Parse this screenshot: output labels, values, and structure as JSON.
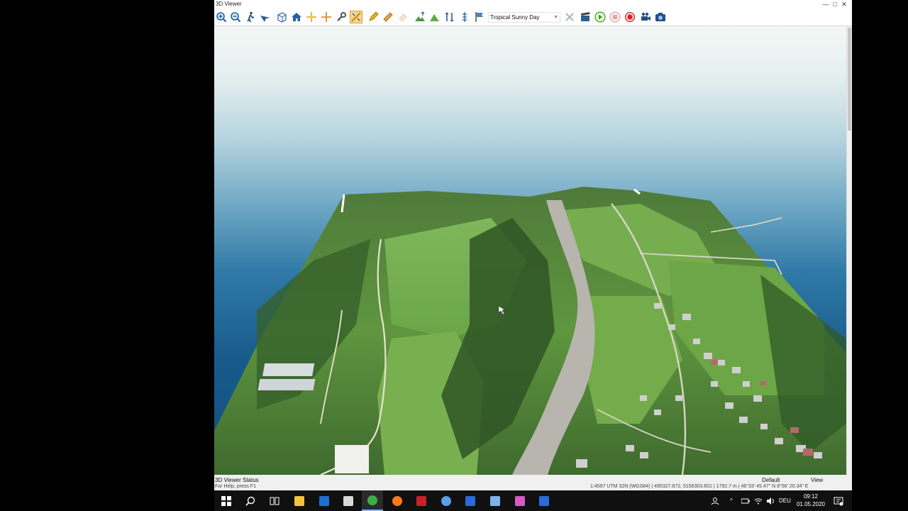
{
  "window": {
    "title": "3D Viewer",
    "controls": {
      "minimize": "—",
      "maximize": "□",
      "close": "✕"
    }
  },
  "toolbar": {
    "buttons": [
      {
        "name": "zoom-in-icon",
        "active": false
      },
      {
        "name": "zoom-out-icon",
        "active": false
      },
      {
        "name": "walk-icon",
        "active": false
      },
      {
        "name": "fly-icon",
        "active": false
      },
      {
        "name": "cube-view-icon",
        "active": false
      },
      {
        "name": "home-icon",
        "active": false
      },
      {
        "name": "center-point-icon",
        "active": false
      },
      {
        "name": "crosshair-icon",
        "active": false
      },
      {
        "name": "wrench-icon",
        "active": false
      },
      {
        "name": "measure-mode-icon",
        "active": true
      },
      {
        "name": "pencil-icon",
        "active": false
      },
      {
        "name": "ruler-icon",
        "active": false
      },
      {
        "name": "eraser-icon",
        "active": false
      },
      {
        "name": "terrain-up-icon",
        "active": false
      },
      {
        "name": "terrain-icon",
        "active": false
      },
      {
        "name": "elevation-icon",
        "active": false
      },
      {
        "name": "elevation-scale-icon",
        "active": false
      },
      {
        "name": "flag-icon",
        "active": false
      }
    ],
    "sky_select": {
      "value": "Tropical Sunny Day"
    },
    "buttons_right": [
      {
        "name": "clear-tools-icon",
        "disabled": true
      },
      {
        "name": "clapperboard-icon",
        "disabled": false
      },
      {
        "name": "play-icon",
        "disabled": false
      },
      {
        "name": "stop-icon",
        "disabled": true
      },
      {
        "name": "record-icon",
        "disabled": false
      },
      {
        "name": "video-camera-icon",
        "disabled": false
      },
      {
        "name": "camera-icon",
        "disabled": false
      }
    ]
  },
  "statusbar": {
    "title": "3D Viewer Status",
    "help": "For Help, press F1",
    "coords": "1:4597 UTM 32N (WGS84) | 495327.872, 5156303.601 | 1792.7 m | 46°33' 45.47\" N 8°56' 20.34\" E",
    "scheme": "Default",
    "mode": "View"
  },
  "taskbar": {
    "apps": [
      {
        "name": "start-icon",
        "color": "#ffffff"
      },
      {
        "name": "search-icon",
        "color": "#ffffff"
      },
      {
        "name": "task-view-icon",
        "color": "#ffffff"
      },
      {
        "name": "file-explorer-icon",
        "color": "#f3c33a"
      },
      {
        "name": "outlook-icon",
        "color": "#1f6fd1"
      },
      {
        "name": "app-window-icon",
        "color": "#d9d9d9"
      },
      {
        "name": "chrome-icon",
        "color": "#3fae49",
        "active": true
      },
      {
        "name": "firefox-icon",
        "color": "#ff7a1a"
      },
      {
        "name": "red-app-icon",
        "color": "#c9202a"
      },
      {
        "name": "globe-app-icon",
        "color": "#5aa0e6"
      },
      {
        "name": "visio-icon",
        "color": "#2b6bd8"
      },
      {
        "name": "image-app-icon",
        "color": "#7fb3e8"
      },
      {
        "name": "pen-app-icon",
        "color": "#d65ac7"
      },
      {
        "name": "v-app-icon",
        "color": "#2b6bd8"
      }
    ],
    "tray": {
      "language": "DEU"
    },
    "clock": {
      "time": "09:12",
      "date": "01.05.2020"
    }
  }
}
